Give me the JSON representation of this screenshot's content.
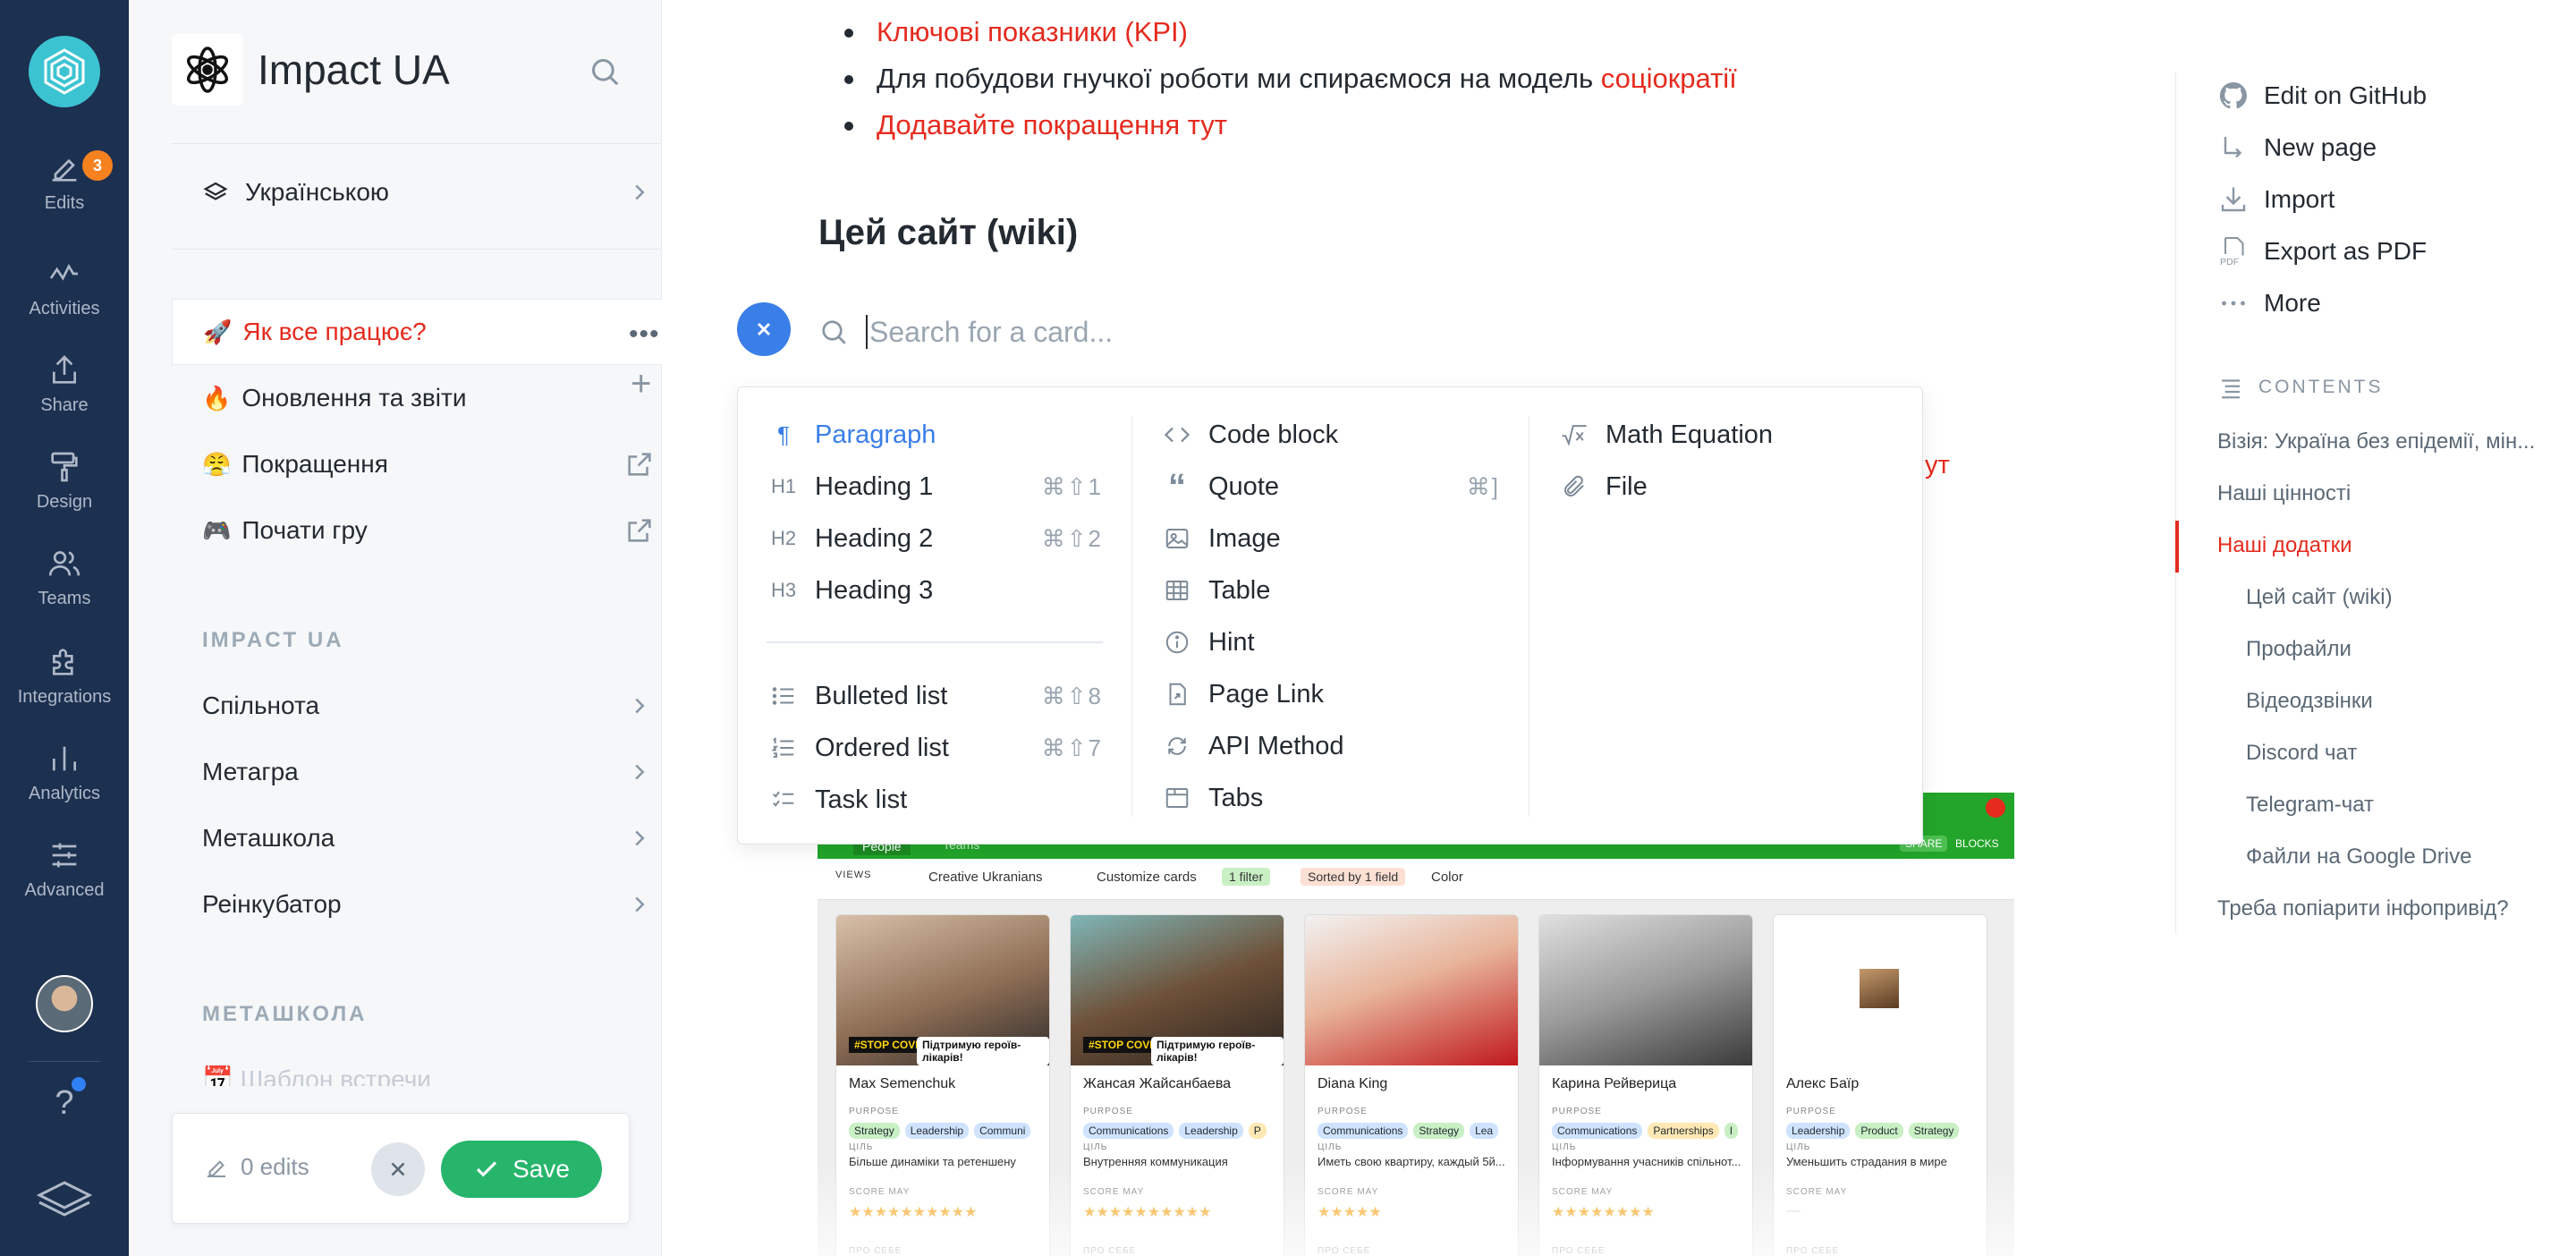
{
  "rail": {
    "items": [
      {
        "label": "Edits",
        "badge": "3"
      },
      {
        "label": "Activities"
      },
      {
        "label": "Share"
      },
      {
        "label": "Design"
      },
      {
        "label": "Teams"
      },
      {
        "label": "Integrations"
      },
      {
        "label": "Analytics"
      },
      {
        "label": "Advanced"
      }
    ],
    "help": "?"
  },
  "sidebar": {
    "title": "Impact UA",
    "language": "Українською",
    "pages": [
      {
        "emoji": "🚀",
        "label": "Як все працює?"
      },
      {
        "emoji": "🔥",
        "label": "Оновлення та звіти"
      },
      {
        "emoji": "😤",
        "label": "Покращення"
      },
      {
        "emoji": "🎮",
        "label": "Почати гру"
      }
    ],
    "section1": "IMPACT UA",
    "groups": [
      "Спільнота",
      "Метагра",
      "Меташкола",
      "Реінкубатор"
    ],
    "section2": "МЕТАШКОЛА",
    "faded_item": "📅 Шаблон встречи",
    "edits_label": "0 edits",
    "save_label": "Save"
  },
  "main": {
    "bullets": [
      {
        "text": "Ключові показники (KPI)"
      },
      {
        "text": "Для побудови гнучкої роботи ми спираємося на модель ",
        "link": "соціократії"
      },
      {
        "text": "Додавайте покращення тут"
      }
    ],
    "heading": "Цей сайт (wiki)",
    "search_placeholder": "Search for a card...",
    "behind_text": "ут",
    "menu": {
      "col1": [
        {
          "icon": "paragraph-icon",
          "label": "Paragraph",
          "kbd": ""
        },
        {
          "icon": "heading1-icon",
          "label": "Heading 1",
          "kbd": "⌘⇧1"
        },
        {
          "icon": "heading2-icon",
          "label": "Heading 2",
          "kbd": "⌘⇧2"
        },
        {
          "icon": "heading3-icon",
          "label": "Heading 3",
          "kbd": ""
        },
        {
          "icon": "bulleted-list-icon",
          "label": "Bulleted list",
          "kbd": "⌘⇧8"
        },
        {
          "icon": "ordered-list-icon",
          "label": "Ordered list",
          "kbd": "⌘⇧7"
        },
        {
          "icon": "task-list-icon",
          "label": "Task list",
          "kbd": ""
        }
      ],
      "col2": [
        {
          "icon": "code-icon",
          "label": "Code block",
          "kbd": ""
        },
        {
          "icon": "quote-icon",
          "label": "Quote",
          "kbd": "⌘]"
        },
        {
          "icon": "image-icon",
          "label": "Image",
          "kbd": ""
        },
        {
          "icon": "table-icon",
          "label": "Table",
          "kbd": ""
        },
        {
          "icon": "hint-icon",
          "label": "Hint",
          "kbd": ""
        },
        {
          "icon": "page-link-icon",
          "label": "Page Link",
          "kbd": ""
        },
        {
          "icon": "api-method-icon",
          "label": "API Method",
          "kbd": ""
        },
        {
          "icon": "tabs-icon",
          "label": "Tabs",
          "kbd": ""
        }
      ],
      "col3": [
        {
          "icon": "math-icon",
          "label": "Math Equation",
          "kbd": ""
        },
        {
          "icon": "file-icon",
          "label": "File",
          "kbd": ""
        }
      ]
    },
    "preview": {
      "tabs": [
        "People",
        "Teams"
      ],
      "toolbar": [
        "VIEWS",
        "Creative Ukranians",
        "Customize cards",
        "1 filter",
        "Sorted by 1 field",
        "Color"
      ],
      "share": "SHARE",
      "blocks": "BLOCKS",
      "stop_label": "#STOP COVID",
      "support_label": "Підтримую героїв-лікарів!",
      "purpose_label": "PURPOSE",
      "goal_label": "ЦІЛЬ",
      "score_label": "SCORE MAY",
      "about_label": "ПРО СЕБЕ",
      "cards": [
        {
          "name": "Max Semenchuk",
          "tags": [
            "Strategy",
            "Leadership",
            "Communi"
          ],
          "goal": "Більше динаміки та ретеншену",
          "stars": "★★★★★★★★★★"
        },
        {
          "name": "Жансая Жайсанбаева",
          "tags": [
            "Communications",
            "Leadership",
            "P"
          ],
          "goal": "Внутренняя коммуникация",
          "stars": "★★★★★★★★★★"
        },
        {
          "name": "Diana King",
          "tags": [
            "Communications",
            "Strategy",
            "Lea"
          ],
          "goal": "Иметь свою квартиру, каждый 5й...",
          "stars": "★★★★★"
        },
        {
          "name": "Карина Рейверица",
          "tags": [
            "Communications",
            "Partnerships",
            "I"
          ],
          "goal": "Інформування учасників спільнот...",
          "stars": "★★★★★★★★"
        },
        {
          "name": "Алекс Баїр",
          "tags": [
            "Leadership",
            "Product",
            "Strategy"
          ],
          "goal": "Уменьшить страдания в мире",
          "stars": "—"
        }
      ]
    }
  },
  "right": {
    "actions": [
      "Edit on GitHub",
      "New page",
      "Import",
      "Export as PDF",
      "More"
    ],
    "contents_label": "CONTENTS",
    "toc": [
      {
        "label": "Візія: Україна без епідемії, мін...",
        "level": 1
      },
      {
        "label": "Наші цінності",
        "level": 1
      },
      {
        "label": "Наші додатки",
        "level": 1,
        "active": true
      },
      {
        "label": "Цей сайт (wiki)",
        "level": 2
      },
      {
        "label": "Профайли",
        "level": 2
      },
      {
        "label": "Відеодзвінки",
        "level": 2
      },
      {
        "label": "Discord чат",
        "level": 2
      },
      {
        "label": "Telegram-чат",
        "level": 2
      },
      {
        "label": "Файли на Google Drive",
        "level": 2
      },
      {
        "label": "Треба попіарити інфопривід?",
        "level": 1
      }
    ]
  },
  "colors": {
    "rail_bg": "#1c3050",
    "accent_blue": "#3a7ee8",
    "link_red": "#e52a1e",
    "save_green": "#26b56b",
    "badge_orange": "#f5821f"
  }
}
